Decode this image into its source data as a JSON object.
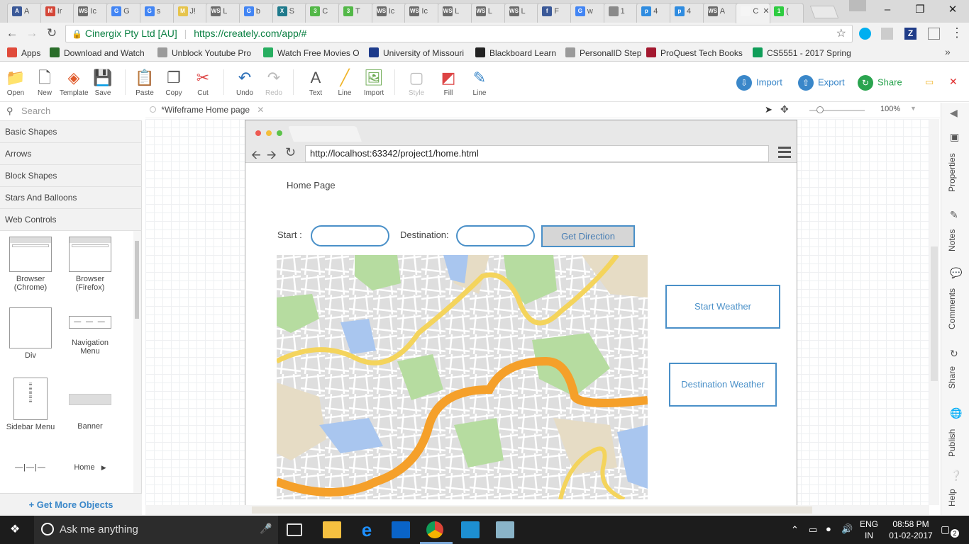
{
  "browser": {
    "tabs": [
      {
        "icon_color": "#3b5998",
        "letter": "A",
        "label": "A"
      },
      {
        "icon_color": "#d44638",
        "letter": "M",
        "label": "Ir"
      },
      {
        "icon_color": "#6b6b6b",
        "letter": "WS",
        "label": "Ic"
      },
      {
        "icon_color": "#4285f4",
        "letter": "G",
        "label": "G"
      },
      {
        "icon_color": "#4285f4",
        "letter": "G",
        "label": "s"
      },
      {
        "icon_color": "#e6c44c",
        "letter": "M",
        "label": "J!"
      },
      {
        "icon_color": "#6b6b6b",
        "letter": "WS",
        "label": "L"
      },
      {
        "icon_color": "#4285f4",
        "letter": "G",
        "label": "b"
      },
      {
        "icon_color": "#1f7a8c",
        "letter": "X",
        "label": "S"
      },
      {
        "icon_color": "#53b848",
        "letter": "3",
        "label": "C"
      },
      {
        "icon_color": "#53b848",
        "letter": "3",
        "label": "T"
      },
      {
        "icon_color": "#6b6b6b",
        "letter": "WS",
        "label": "Ic"
      },
      {
        "icon_color": "#6b6b6b",
        "letter": "WS",
        "label": "Ic"
      },
      {
        "icon_color": "#6b6b6b",
        "letter": "WS",
        "label": "L"
      },
      {
        "icon_color": "#6b6b6b",
        "letter": "WS",
        "label": "L"
      },
      {
        "icon_color": "#6b6b6b",
        "letter": "WS",
        "label": "L"
      },
      {
        "icon_color": "#3b5998",
        "letter": "f",
        "label": "F"
      },
      {
        "icon_color": "#4285f4",
        "letter": "G",
        "label": "w"
      },
      {
        "icon_color": "#8a8a8a",
        "letter": "",
        "label": "1"
      },
      {
        "icon_color": "#2f8ce0",
        "letter": "p",
        "label": "4"
      },
      {
        "icon_color": "#2f8ce0",
        "letter": "p",
        "label": "4"
      },
      {
        "icon_color": "#6b6b6b",
        "letter": "WS",
        "label": "A"
      },
      {
        "icon_color": "#f5f5f5",
        "letter": "",
        "label": "C"
      },
      {
        "icon_color": "#2ecc40",
        "letter": "1",
        "label": "("
      }
    ],
    "address": {
      "site_identity": "Cinergix Pty Ltd [AU]",
      "url": "https://creately.com/app/#"
    },
    "bookmarks": [
      {
        "label": "Apps",
        "color": "#e04a3a"
      },
      {
        "label": "Download and Watch",
        "color": "#2a6e2a"
      },
      {
        "label": "Unblock Youtube Pro",
        "color": "#9a9a9a"
      },
      {
        "label": "Watch Free Movies O",
        "color": "#27ae60"
      },
      {
        "label": "University of Missouri",
        "color": "#1e3c8c"
      },
      {
        "label": "Blackboard Learn",
        "color": "#222222"
      },
      {
        "label": "PersonalID Step",
        "color": "#9a9a9a"
      },
      {
        "label": "ProQuest Tech Books",
        "color": "#a3182f"
      },
      {
        "label": "CS5551 - 2017 Spring",
        "color": "#0f9d58"
      }
    ]
  },
  "toolbar": {
    "left": [
      {
        "label": "Open",
        "icon": "folder-icon"
      },
      {
        "label": "New",
        "icon": "new-document-icon"
      },
      {
        "label": "Template",
        "icon": "template-icon"
      },
      {
        "label": "Save",
        "icon": "save-icon"
      },
      {
        "label": "Paste",
        "icon": "paste-icon"
      },
      {
        "label": "Copy",
        "icon": "copy-icon"
      },
      {
        "label": "Cut",
        "icon": "scissors-icon"
      },
      {
        "label": "Undo",
        "icon": "undo-icon"
      },
      {
        "label": "Redo",
        "icon": "redo-icon"
      },
      {
        "label": "Text",
        "icon": "text-icon"
      },
      {
        "label": "Line",
        "icon": "line-icon"
      },
      {
        "label": "Import",
        "icon": "image-icon"
      },
      {
        "label": "Style",
        "icon": "style-icon"
      },
      {
        "label": "Fill",
        "icon": "fill-bucket-icon"
      },
      {
        "label": "Line",
        "icon": "pencil-icon"
      }
    ],
    "import_label": "Import",
    "export_label": "Export",
    "share_label": "Share"
  },
  "leftpanel": {
    "search_placeholder": "Search",
    "categories": [
      "Basic Shapes",
      "Arrows",
      "Block Shapes",
      "Stars And Balloons",
      "Web Controls"
    ],
    "shapes": [
      {
        "label": "Browser\n(Chrome)"
      },
      {
        "label": "Browser\n(Firefox)"
      },
      {
        "label": "Div"
      },
      {
        "label": "Navigation\nMenu"
      },
      {
        "label": "Sidebar Menu"
      },
      {
        "label": "Banner"
      },
      {
        "label": "Home"
      }
    ],
    "more_objects": "+ Get More Objects"
  },
  "document": {
    "tab_title": "*Wifeframe Home page",
    "zoom": "100%"
  },
  "wireframe": {
    "url": "http://localhost:63342/project1/home.html",
    "page_title": "Home Page",
    "start_label": "Start :",
    "destination_label": "Destination:",
    "get_direction": "Get Direction",
    "start_weather": "Start Weather",
    "destination_weather": "Destination Weather"
  },
  "rightbar": [
    "Properties",
    "Notes",
    "Comments",
    "Share",
    "Publish",
    "Help"
  ],
  "taskbar": {
    "search_placeholder": "Ask me anything",
    "language": "ENG",
    "region": "IN",
    "time": "08:58 PM",
    "date": "01-02-2017",
    "notification_count": "2"
  }
}
